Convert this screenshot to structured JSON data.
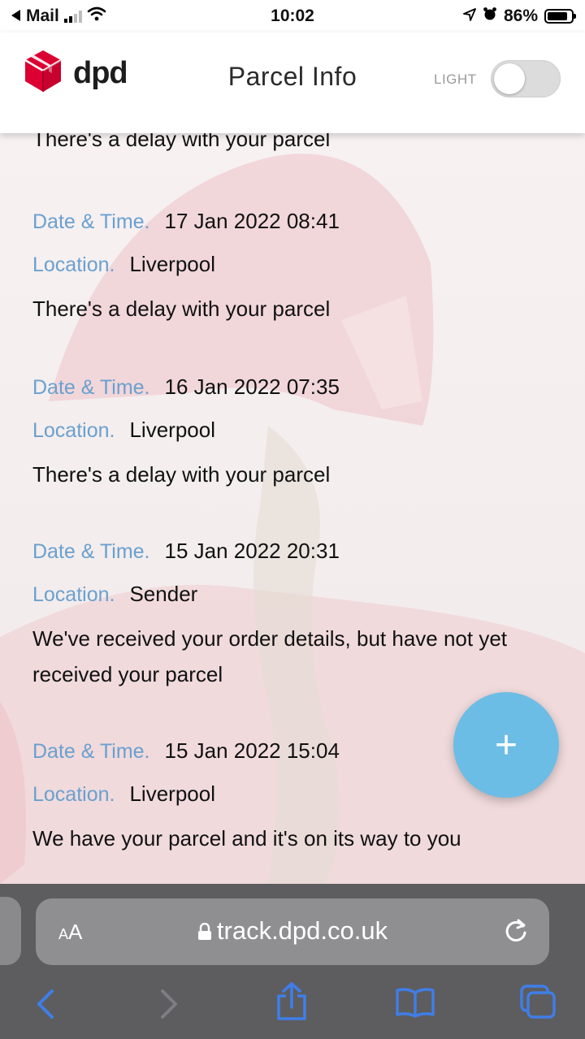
{
  "status_bar": {
    "back_app": "Mail",
    "time": "10:02",
    "battery": "86%",
    "battery_level": 0.86,
    "icons": [
      "back-arrow-icon",
      "signal-icon",
      "wifi-icon",
      "location-icon",
      "alarm-icon",
      "battery-icon"
    ]
  },
  "header": {
    "logo_text": "dpd",
    "title": "Parcel Info",
    "theme_label": "LIGHT",
    "toggle_on": false
  },
  "colors": {
    "label_blue": "#6aa0cf",
    "fab_blue": "#6cbde5",
    "dpd_red": "#dc0032",
    "safari_bar": "#5d5d5f",
    "toolbar_blue": "#3f7ee8"
  },
  "events": {
    "partial_text": "There's a delay with your parcel",
    "date_label": "Date & Time.",
    "location_label": "Location.",
    "items": [
      {
        "datetime": "17 Jan 2022 08:41",
        "location": "Liverpool",
        "message": "There's a delay with your parcel"
      },
      {
        "datetime": "16 Jan 2022 07:35",
        "location": "Liverpool",
        "message": "There's a delay with your parcel"
      },
      {
        "datetime": "15 Jan 2022 20:31",
        "location": "Sender",
        "message": "We've received your order details, but have not yet received your parcel"
      },
      {
        "datetime": "15 Jan 2022 15:04",
        "location": "Liverpool",
        "message": "We have your parcel and it's on its way to you"
      }
    ]
  },
  "fab": {
    "label": "+"
  },
  "browser": {
    "aa_big": "A",
    "aa_small": "A",
    "url": "track.dpd.co.uk",
    "toolbar_icons": [
      "back-icon",
      "forward-icon",
      "share-icon",
      "bookmarks-icon",
      "tabs-icon"
    ]
  }
}
